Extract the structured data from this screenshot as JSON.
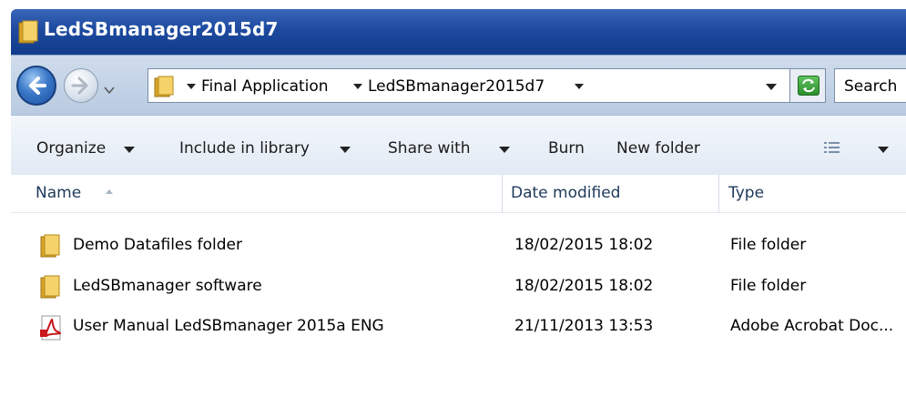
{
  "window": {
    "title": "LedSBmanager2015d7"
  },
  "navigation": {
    "breadcrumbs": [
      "Final Application",
      "LedSBmanager2015d7"
    ],
    "search_placeholder": "Search"
  },
  "toolbar": {
    "organize": "Organize",
    "include_in_library": "Include in library",
    "share_with": "Share with",
    "burn": "Burn",
    "new_folder": "New folder"
  },
  "columns": {
    "name": "Name",
    "date_modified": "Date modified",
    "type": "Type"
  },
  "files": [
    {
      "name": "Demo Datafiles folder",
      "date": "18/02/2015 18:02",
      "type": "File folder",
      "icon": "folder-icon"
    },
    {
      "name": "LedSBmanager software",
      "date": "18/02/2015 18:02",
      "type": "File folder",
      "icon": "folder-icon"
    },
    {
      "name": "User Manual LedSBmanager 2015a ENG",
      "date": "21/11/2013 13:53",
      "type": "Adobe Acrobat Doc...",
      "icon": "pdf-icon"
    }
  ],
  "colors": {
    "titlebar": "#1d4a9f",
    "navbar": "#c4d4e8",
    "toolbar": "#e8eef6",
    "folder": "#e8b93a",
    "pdf": "#c8161b"
  }
}
